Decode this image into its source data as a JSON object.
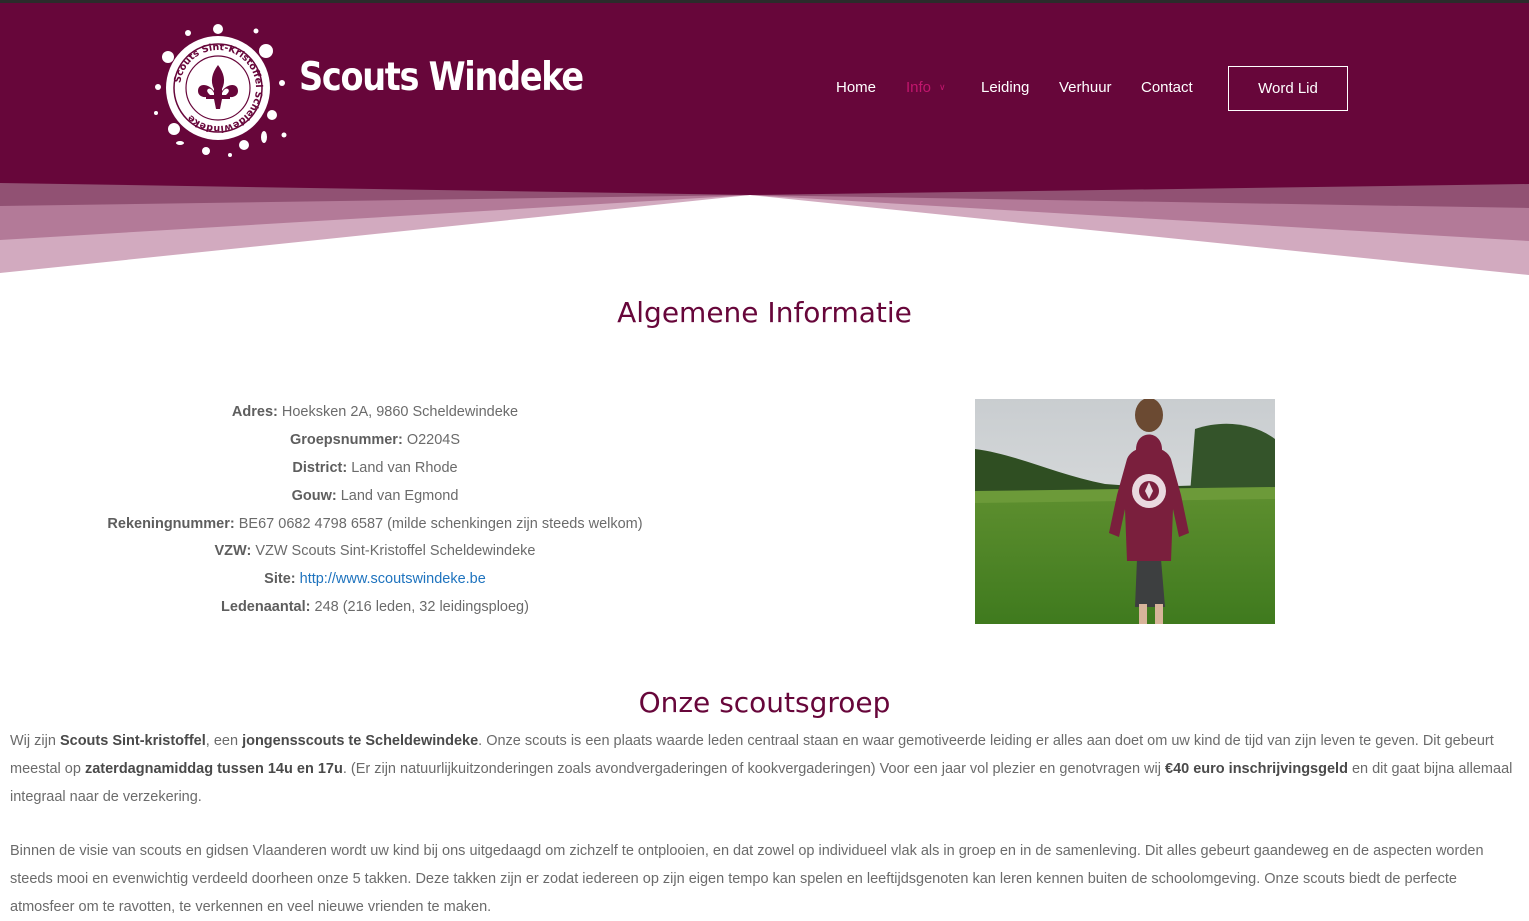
{
  "brand": {
    "logo_badge_text": "Scouts Sint-Kristoffel Scheldewindeke",
    "site_title": "Scouts Windeke"
  },
  "nav": {
    "items": [
      {
        "label": "Home"
      },
      {
        "label": "Info"
      },
      {
        "label": "Leiding"
      },
      {
        "label": "Verhuur"
      },
      {
        "label": "Contact"
      }
    ],
    "cta_label": "Word Lid"
  },
  "info_section": {
    "heading": "Algemene Informatie",
    "rows": [
      {
        "label": "Adres:",
        "value": "Hoeksken 2A, 9860 Scheldewindeke"
      },
      {
        "label": "Groepsnummer:",
        "value": "O2204S"
      },
      {
        "label": "District:",
        "value": "Land van Rhode"
      },
      {
        "label": "Gouw:",
        "value": "Land van Egmond"
      },
      {
        "label": "Rekeningnummer:",
        "value": "BE67 0682 4798 6587 (milde schenkingen zijn steeds welkom)"
      },
      {
        "label": "VZW:",
        "value": "VZW Scouts Sint-Kristoffel Scheldewindeke"
      },
      {
        "label": "Site:",
        "value": "http://www.scoutswindeke.be"
      },
      {
        "label": "Ledenaantal:",
        "value": "248 (216 leden, 32 leidingsploeg)"
      }
    ]
  },
  "group_section": {
    "heading": "Onze scoutsgroep",
    "p1": {
      "t1": "Wij zijn ",
      "b1": "Scouts Sint-kristoffel",
      "t2": ", een ",
      "b2": "jongensscouts te Scheldewindeke",
      "t3": ". Onze scouts is een plaats waarde leden centraal staan en waar gemotiveerde leiding er alles aan doet om uw kind de tijd van zijn leven te geven. Dit gebeurt meestal op ",
      "b3": "zaterdagnamiddag tussen 14u en 17u",
      "t4": ". (Er zijn natuurlijkuitzonderingen zoals avondvergaderingen of kookvergaderingen) Voor een jaar vol plezier en genotvragen wij ",
      "b4": "€40 euro inschrijvingsgeld",
      "t5": " en dit gaat bijna allemaal integraal naar de verzekering."
    },
    "p2": "Binnen de visie van scouts en gidsen Vlaanderen wordt uw kind bij ons uitgedaagd om zichzelf te ontplooien, en dat zowel op individueel vlak als in groep en in de samenleving. Dit alles gebeurt gaandeweg en de aspecten worden steeds mooi en evenwichtig verdeeld doorheen onze 5 takken. Deze takken zijn er zodat iedereen op zijn eigen tempo kan spelen en leeftijdsgenoten kan leren kennen buiten de schoolomgeving. Onze scouts biedt de perfecte atmosfeer om te ravotten, te verkennen en veel nieuwe vrienden te maken."
  },
  "colors": {
    "header_bg": "#67063a",
    "nav_active": "#c2166e",
    "heading": "#67063a",
    "link": "#1e73be"
  },
  "icons": {
    "info_dropdown": "chevron-down-icon",
    "logo": "fleur-de-lis-splash-logo"
  }
}
